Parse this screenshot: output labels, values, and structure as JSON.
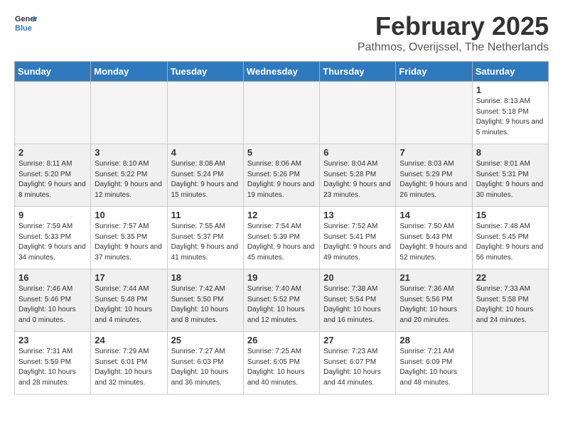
{
  "logo": {
    "line1": "General",
    "line2": "Blue"
  },
  "title": "February 2025",
  "subtitle": "Pathmos, Overijssel, The Netherlands",
  "days_of_week": [
    "Sunday",
    "Monday",
    "Tuesday",
    "Wednesday",
    "Thursday",
    "Friday",
    "Saturday"
  ],
  "weeks": [
    [
      {
        "day": "",
        "info": ""
      },
      {
        "day": "",
        "info": ""
      },
      {
        "day": "",
        "info": ""
      },
      {
        "day": "",
        "info": ""
      },
      {
        "day": "",
        "info": ""
      },
      {
        "day": "",
        "info": ""
      },
      {
        "day": "1",
        "info": "Sunrise: 8:13 AM\nSunset: 5:18 PM\nDaylight: 9 hours and 5 minutes."
      }
    ],
    [
      {
        "day": "2",
        "info": "Sunrise: 8:11 AM\nSunset: 5:20 PM\nDaylight: 9 hours and 8 minutes."
      },
      {
        "day": "3",
        "info": "Sunrise: 8:10 AM\nSunset: 5:22 PM\nDaylight: 9 hours and 12 minutes."
      },
      {
        "day": "4",
        "info": "Sunrise: 8:08 AM\nSunset: 5:24 PM\nDaylight: 9 hours and 15 minutes."
      },
      {
        "day": "5",
        "info": "Sunrise: 8:06 AM\nSunset: 5:26 PM\nDaylight: 9 hours and 19 minutes."
      },
      {
        "day": "6",
        "info": "Sunrise: 8:04 AM\nSunset: 5:28 PM\nDaylight: 9 hours and 23 minutes."
      },
      {
        "day": "7",
        "info": "Sunrise: 8:03 AM\nSunset: 5:29 PM\nDaylight: 9 hours and 26 minutes."
      },
      {
        "day": "8",
        "info": "Sunrise: 8:01 AM\nSunset: 5:31 PM\nDaylight: 9 hours and 30 minutes."
      }
    ],
    [
      {
        "day": "9",
        "info": "Sunrise: 7:59 AM\nSunset: 5:33 PM\nDaylight: 9 hours and 34 minutes."
      },
      {
        "day": "10",
        "info": "Sunrise: 7:57 AM\nSunset: 5:35 PM\nDaylight: 9 hours and 37 minutes."
      },
      {
        "day": "11",
        "info": "Sunrise: 7:55 AM\nSunset: 5:37 PM\nDaylight: 9 hours and 41 minutes."
      },
      {
        "day": "12",
        "info": "Sunrise: 7:54 AM\nSunset: 5:39 PM\nDaylight: 9 hours and 45 minutes."
      },
      {
        "day": "13",
        "info": "Sunrise: 7:52 AM\nSunset: 5:41 PM\nDaylight: 9 hours and 49 minutes."
      },
      {
        "day": "14",
        "info": "Sunrise: 7:50 AM\nSunset: 5:43 PM\nDaylight: 9 hours and 52 minutes."
      },
      {
        "day": "15",
        "info": "Sunrise: 7:48 AM\nSunset: 5:45 PM\nDaylight: 9 hours and 56 minutes."
      }
    ],
    [
      {
        "day": "16",
        "info": "Sunrise: 7:46 AM\nSunset: 5:46 PM\nDaylight: 10 hours and 0 minutes."
      },
      {
        "day": "17",
        "info": "Sunrise: 7:44 AM\nSunset: 5:48 PM\nDaylight: 10 hours and 4 minutes."
      },
      {
        "day": "18",
        "info": "Sunrise: 7:42 AM\nSunset: 5:50 PM\nDaylight: 10 hours and 8 minutes."
      },
      {
        "day": "19",
        "info": "Sunrise: 7:40 AM\nSunset: 5:52 PM\nDaylight: 10 hours and 12 minutes."
      },
      {
        "day": "20",
        "info": "Sunrise: 7:38 AM\nSunset: 5:54 PM\nDaylight: 10 hours and 16 minutes."
      },
      {
        "day": "21",
        "info": "Sunrise: 7:36 AM\nSunset: 5:56 PM\nDaylight: 10 hours and 20 minutes."
      },
      {
        "day": "22",
        "info": "Sunrise: 7:33 AM\nSunset: 5:58 PM\nDaylight: 10 hours and 24 minutes."
      }
    ],
    [
      {
        "day": "23",
        "info": "Sunrise: 7:31 AM\nSunset: 5:59 PM\nDaylight: 10 hours and 28 minutes."
      },
      {
        "day": "24",
        "info": "Sunrise: 7:29 AM\nSunset: 6:01 PM\nDaylight: 10 hours and 32 minutes."
      },
      {
        "day": "25",
        "info": "Sunrise: 7:27 AM\nSunset: 6:03 PM\nDaylight: 10 hours and 36 minutes."
      },
      {
        "day": "26",
        "info": "Sunrise: 7:25 AM\nSunset: 6:05 PM\nDaylight: 10 hours and 40 minutes."
      },
      {
        "day": "27",
        "info": "Sunrise: 7:23 AM\nSunset: 6:07 PM\nDaylight: 10 hours and 44 minutes."
      },
      {
        "day": "28",
        "info": "Sunrise: 7:21 AM\nSunset: 6:09 PM\nDaylight: 10 hours and 48 minutes."
      },
      {
        "day": "",
        "info": ""
      }
    ]
  ]
}
